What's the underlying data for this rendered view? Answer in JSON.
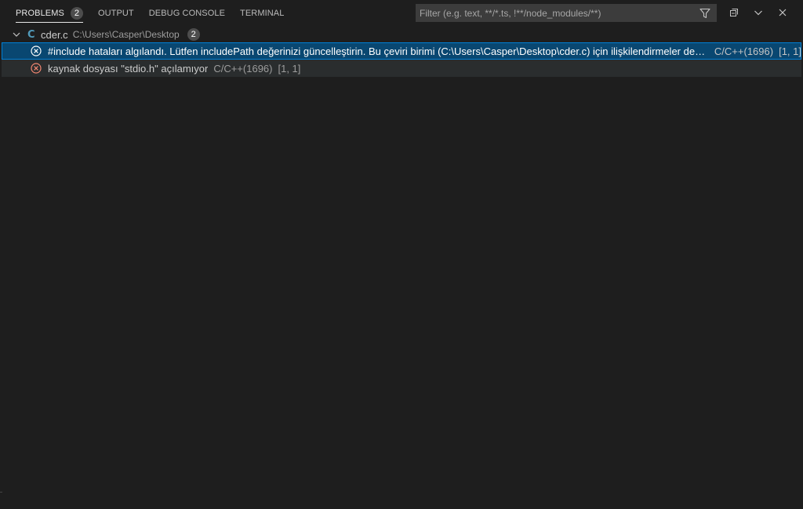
{
  "tabs": [
    {
      "label": "PROBLEMS",
      "badge": "2",
      "active": true
    },
    {
      "label": "OUTPUT"
    },
    {
      "label": "DEBUG CONSOLE"
    },
    {
      "label": "TERMINAL"
    }
  ],
  "filter": {
    "placeholder": "Filter (e.g. text, **/*.ts, !**/node_modules/**)",
    "value": "",
    "icon": "filter-icon"
  },
  "actions": {
    "collapse_icon": "collapse-all-icon",
    "maximize_icon": "chevron-down-icon",
    "close_icon": "close-icon"
  },
  "file": {
    "icon_letter": "C",
    "name": "cder.c",
    "path": "C:\\Users\\Casper\\Desktop",
    "count": "2"
  },
  "problems": [
    {
      "message": "#include hataları algılandı. Lütfen includePath değerinizi güncelleştirin. Bu çeviri birimi (C:\\Users\\Casper\\Desktop\\cder.c) için ilişkilendirmeler devre dışı bırakıldı.",
      "source": "C/C++(1696)",
      "position": "[1, 1]"
    },
    {
      "message": "kaynak dosyası \"stdio.h\" açılamıyor",
      "source": "C/C++(1696)",
      "position": "[1, 1]"
    }
  ],
  "colors": {
    "background": "#1e1e1e",
    "selection": "#094771",
    "error": "#f48771",
    "c_icon": "#519aba"
  }
}
